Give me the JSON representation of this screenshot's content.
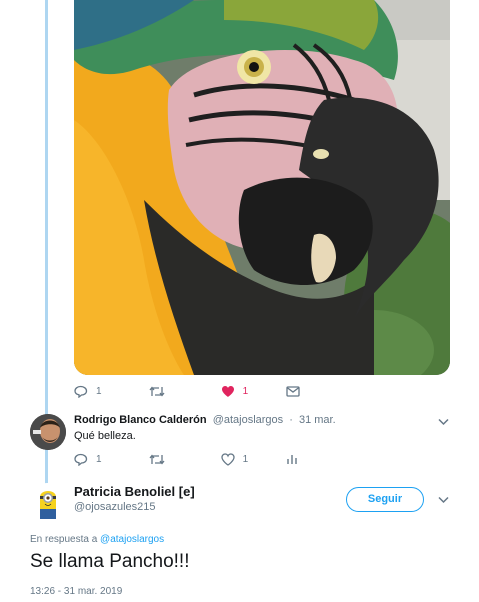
{
  "parent_tweet": {
    "image_alt": "Parrot",
    "actions": {
      "reply_count": "1",
      "retweet_count": "",
      "like_count": "1",
      "dm": ""
    }
  },
  "reply": {
    "name": "Rodrigo Blanco Calderón",
    "handle": "@atajoslargos",
    "date": "31 mar.",
    "separator": "·",
    "text": "Qué belleza.",
    "actions": {
      "reply_count": "1",
      "retweet_count": "",
      "like_count": "1"
    }
  },
  "main": {
    "name": "Patricia Benoliel [e]",
    "handle": "@ojosazules215",
    "follow_label": "Seguir",
    "in_reply_prefix": "En respuesta a",
    "in_reply_handle": "@atajoslargos",
    "text": "Se llama Pancho!!!",
    "timestamp": "13:26 - 31 mar. 2019"
  },
  "colors": {
    "accent": "#1da1f2",
    "like": "#e0245e",
    "thread_line": "#aed6f1",
    "secondary_text": "#657786"
  }
}
